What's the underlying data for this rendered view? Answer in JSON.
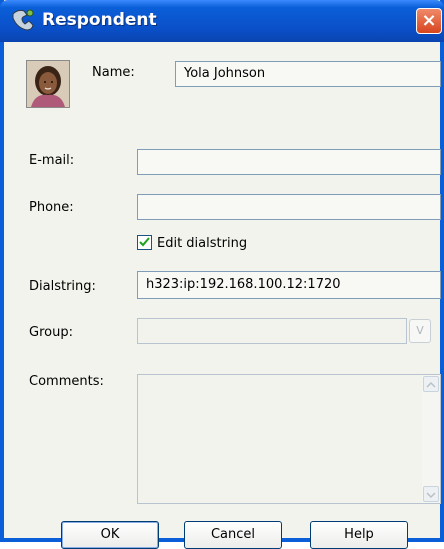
{
  "window": {
    "title": "Respondent",
    "close_glyph": "×",
    "title_icon": "phone-icon"
  },
  "form": {
    "name_label": "Name:",
    "name_value": "Yola Johnson",
    "email_label": "E-mail:",
    "email_value": "",
    "phone_label": "Phone:",
    "phone_value": "",
    "edit_dialstring_label": "Edit dialstring",
    "edit_dialstring_checked": true,
    "dialstring_label": "Dialstring:",
    "dialstring_value": "h323:ip:192.168.100.12:1720",
    "group_label": "Group:",
    "group_value": "",
    "comments_label": "Comments:",
    "comments_value": ""
  },
  "buttons": {
    "ok": "OK",
    "cancel": "Cancel",
    "help": "Help"
  },
  "colors": {
    "title_bar": "#0a5fd8",
    "close": "#d6451e",
    "panel": "#f3f3ee"
  }
}
